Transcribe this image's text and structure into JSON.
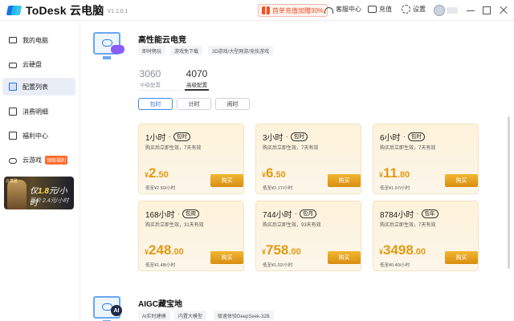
{
  "app": {
    "name": "ToDesk 云电脑",
    "version": "V1.1.0.1"
  },
  "titlebar": {
    "promo": "首单充值加赠30%",
    "service": "客服中心",
    "recharge": "充值",
    "settings": "设置"
  },
  "sidebar": {
    "items": [
      {
        "label": "我的电脑",
        "icon": "monitor-icon"
      },
      {
        "label": "云硬盘",
        "icon": "disk-icon"
      },
      {
        "label": "配置列表",
        "icon": "clipboard-icon",
        "active": true
      },
      {
        "label": "消费明细",
        "icon": "receipt-icon"
      },
      {
        "label": "福利中心",
        "icon": "gift-icon"
      },
      {
        "label": "云游戏",
        "icon": "gamepad-icon",
        "badge": "领取福利"
      }
    ],
    "banner": {
      "tag": "云菓雅",
      "text_prefix": "仅",
      "price": "1.8",
      "text_suffix": "元/小时",
      "original": "原价 2.4元/小时"
    }
  },
  "section1": {
    "title": "高性能云电竞",
    "chips": [
      "即时畅玩",
      "游戏免下载",
      "3D游戏/大型网游/竞技游戏"
    ],
    "tiers": [
      {
        "num": "3060",
        "sub": "中级配置"
      },
      {
        "num": "4070",
        "sub": "高级配置",
        "active": true
      }
    ],
    "tabs": [
      "包时",
      "计时",
      "闲时"
    ],
    "active_tab": "包时",
    "cards": [
      {
        "title": "1小时",
        "badge": "包时",
        "desc": "购买后立即生效，7天有效",
        "price_int": "2",
        "price_dec": ".50",
        "unit": "低至¥2.50/小时",
        "buy": "购买"
      },
      {
        "title": "3小时",
        "badge": "包时",
        "desc": "购买后立即生效，7天有效",
        "price_int": "6",
        "price_dec": ".50",
        "unit": "低至¥2.17/小时",
        "buy": "购买"
      },
      {
        "title": "6小时",
        "badge": "包时",
        "desc": "购买后立即生效，7天有效",
        "price_int": "11",
        "price_dec": ".80",
        "unit": "低至¥1.97/小时",
        "buy": "购买"
      },
      {
        "title": "168小时",
        "badge": "包周",
        "desc": "购买后立即生效，31天有效",
        "price_int": "248",
        "price_dec": ".00",
        "unit": "低至¥1.48/小时",
        "buy": "购买"
      },
      {
        "title": "744小时",
        "badge": "包月",
        "desc": "购买后立即生效，93天有效",
        "price_int": "758",
        "price_dec": ".00",
        "unit": "低至¥1.02/小时",
        "buy": "购买"
      },
      {
        "title": "8784小时",
        "badge": "包年",
        "desc": "购买后立即生效，7天有效",
        "price_int": "3498",
        "price_dec": ".00",
        "unit": "低至¥0.40/小时",
        "buy": "购买"
      }
    ]
  },
  "section2": {
    "title": "AIGC藏宝地",
    "ai_badge": "AI",
    "chips": [
      "AI实时建模",
      "内置大模型",
      "极速体验DeepSeek-32B"
    ]
  },
  "currency": "¥"
}
